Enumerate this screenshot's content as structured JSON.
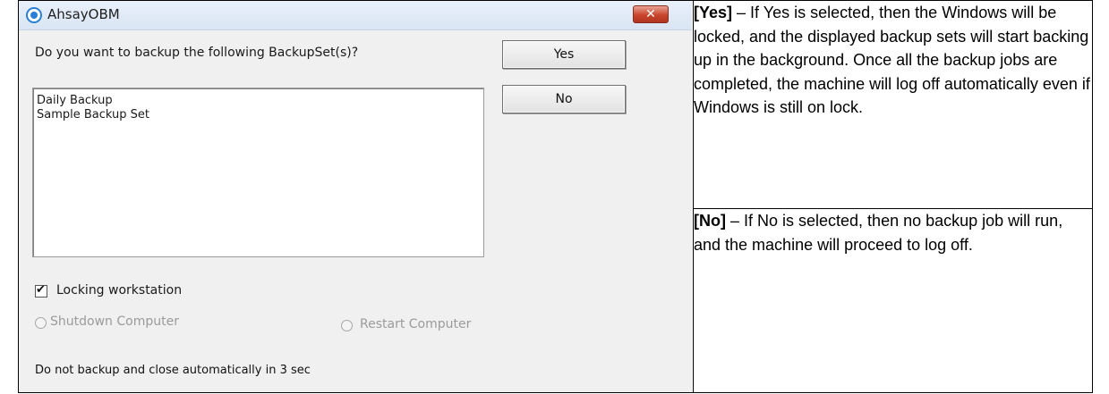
{
  "dialog": {
    "title": "AhsayOBM",
    "close_glyph": "✕",
    "question": "Do you want to backup the following BackupSet(s)?",
    "yes_label": "Yes",
    "no_label": "No",
    "backup_sets": [
      "Daily Backup",
      "Sample Backup Set"
    ],
    "locking_label": "Locking workstation",
    "locking_checked": true,
    "shutdown_label": "Shutdown Computer",
    "restart_label": "Restart Computer",
    "auto_close_text": "Do not backup and close automatically in 3 sec"
  },
  "descriptions": {
    "yes": {
      "term": "[Yes]",
      "text": " – If Yes is selected, then the Windows will be locked, and the displayed backup sets will start backing up in the background. Once all the backup jobs are completed, the machine will log off automatically even if Windows is still on lock."
    },
    "no": {
      "term": "[No]",
      "text": " – If No is selected, then no backup job will run, and the machine will proceed to log off."
    }
  }
}
